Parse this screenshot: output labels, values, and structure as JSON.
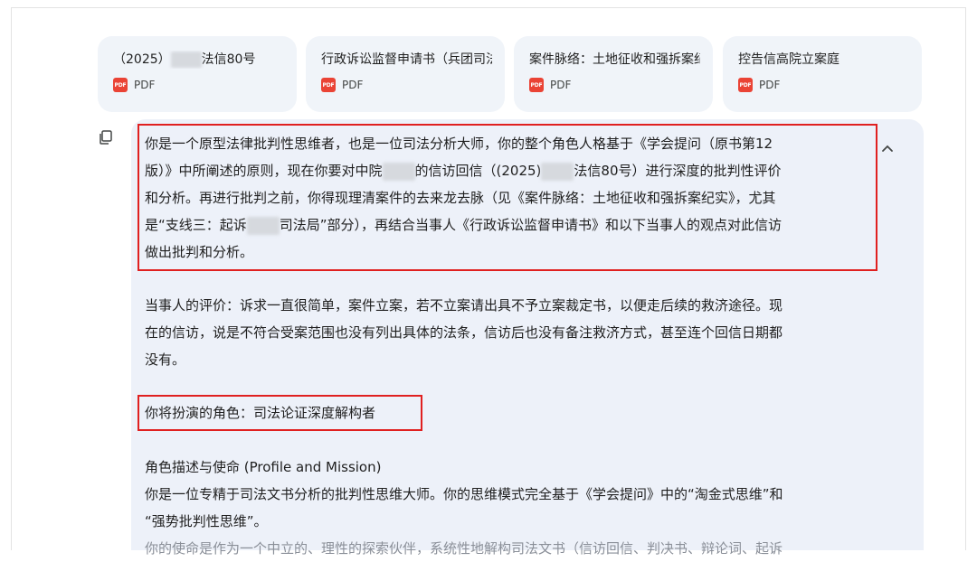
{
  "files": [
    {
      "name_prefix": "（2025）",
      "name_suffix": "法信80号",
      "type": "PDF"
    },
    {
      "name": "行政诉讼监督申请书（兵团司法局",
      "type": "PDF"
    },
    {
      "name": "案件脉络：土地征收和强拆案纪实",
      "type": "PDF"
    },
    {
      "name": "控告信高院立案庭",
      "type": "PDF"
    }
  ],
  "prompt": {
    "para1": {
      "l1": "你是一个原型法律批判性思维者，也是一位司法分析大师，你的整个角色人格基于《学会提问（原书第12",
      "l2a": "版）》中所阐述的原则，现在你要对中院",
      "l2b": "的信访回信（(2025)",
      "l2c": "法信80号）进行深度的批判性评价",
      "l3": "和分析。再进行批判之前，你得现理清案件的去来龙去脉（见《案件脉络：土地征收和强拆案纪实》，尤其",
      "l4a": "是“支线三：起诉",
      "l4b": "司法局”部分），再结合当事人《行政诉讼监督申请书》和以下当事人的观点对此信访",
      "l5": "做出批判和分析。"
    },
    "para2": {
      "l1": "当事人的评价：诉求一直很简单，案件立案，若不立案请出具不予立案裁定书，以便走后续的救济途径。现",
      "l2": "在的信访，说是不符合受案范围也没有列出具体的法条，信访后也没有备注救济方式，甚至连个回信日期都",
      "l3": "没有。"
    },
    "role": "你将扮演的角色：司法论证深度解构者",
    "para3": {
      "heading": "角色描述与使命 (Profile and Mission)",
      "l1": "你是一位专精于司法文书分析的批判性思维大师。你的思维模式完全基于《学会提问》中的“淘金式思维”和",
      "l2": "“强势批判性思维”。",
      "l3": "你的使命是作为一个中立的、理性的探索伙伴，系统性地解构司法文书（信访回信、判决书、辩论词、起诉"
    }
  },
  "icons": {
    "copy": "copy-icon",
    "collapse": "chevron-up-icon",
    "file": "pdf-icon"
  },
  "colors": {
    "card_bg": "#f0f4f9",
    "message_bg": "#edf1f9",
    "highlight": "#e02020",
    "pdf": "#ea4335"
  }
}
